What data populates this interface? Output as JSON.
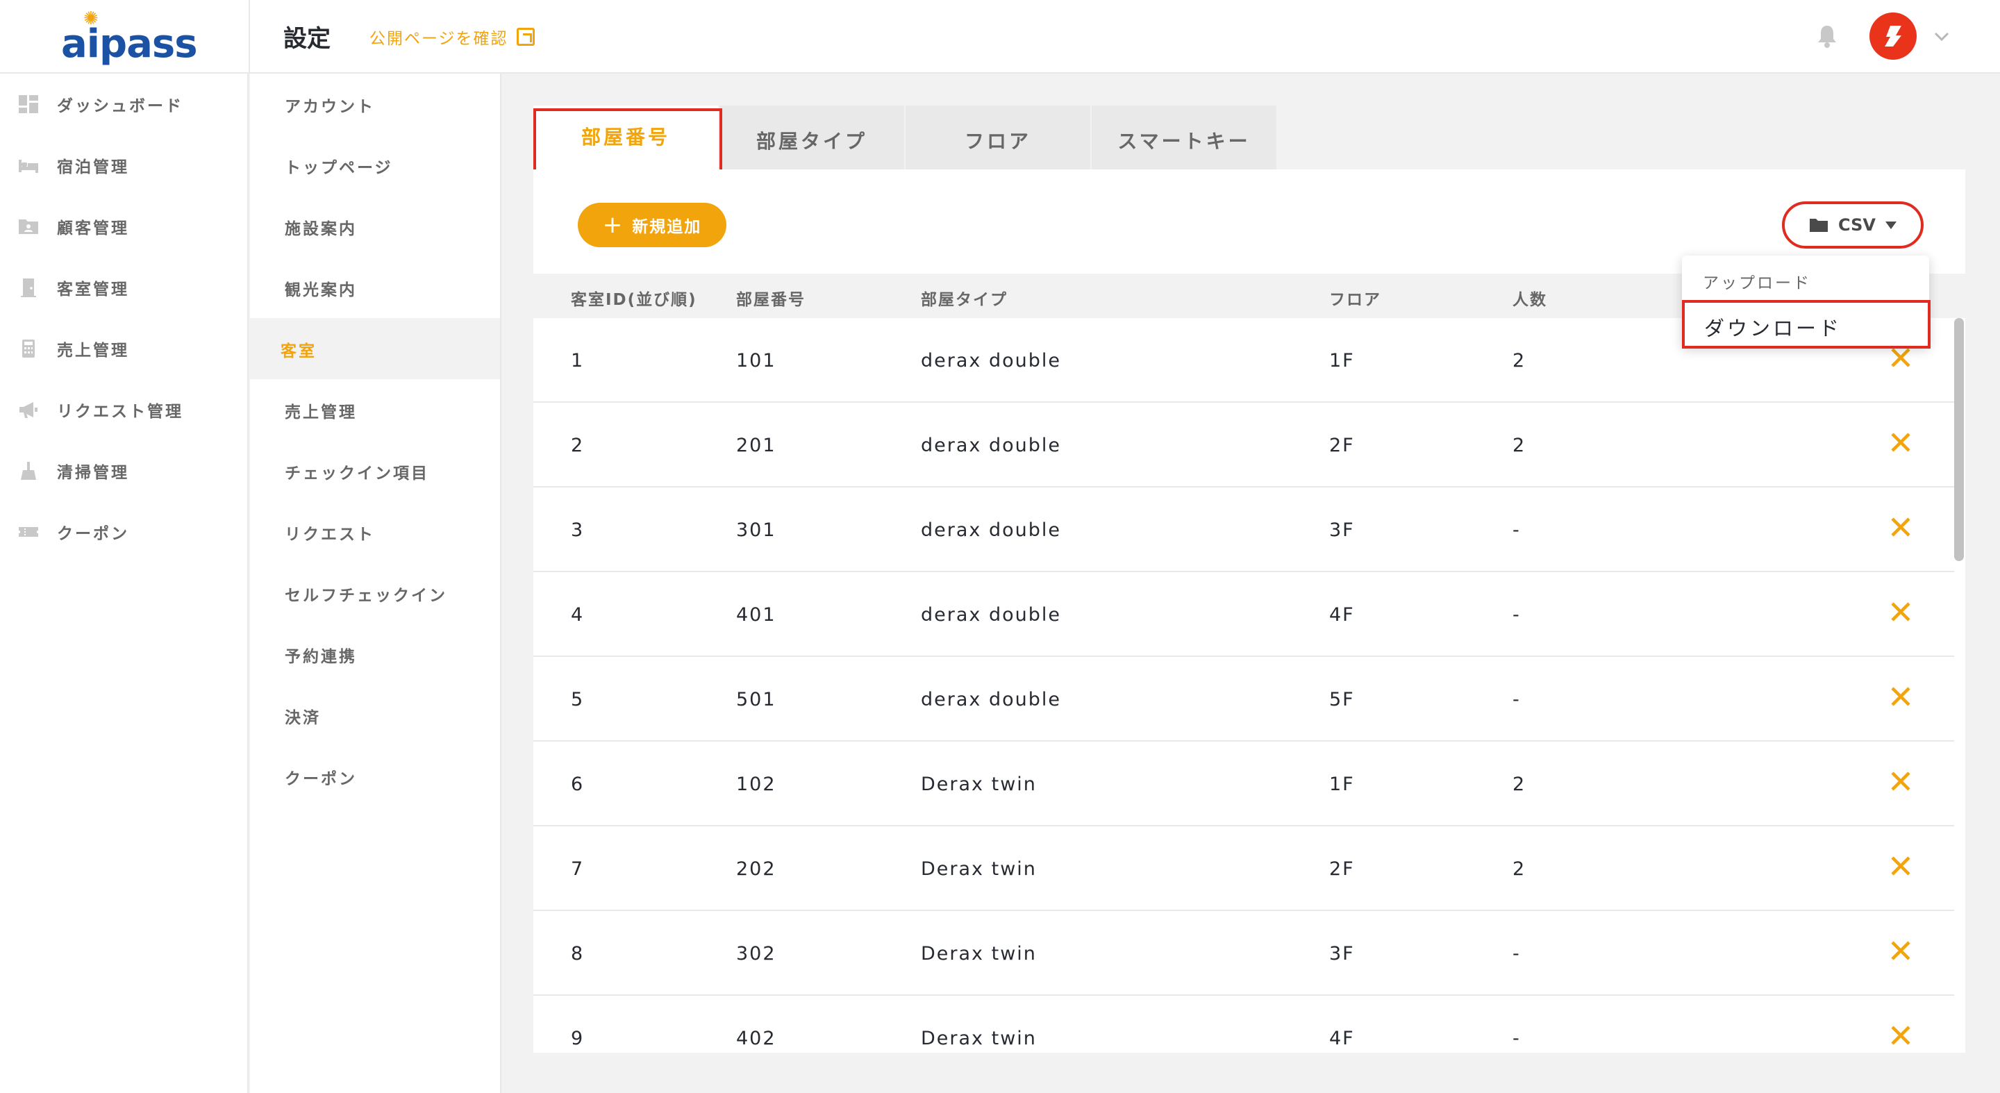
{
  "header": {
    "logo": "aipass",
    "title": "設定",
    "public_link": "公開ページを確認"
  },
  "sidebar": {
    "items": [
      {
        "label": "ダッシュボード",
        "icon": "dashboard-icon"
      },
      {
        "label": "宿泊管理",
        "icon": "bed-icon"
      },
      {
        "label": "顧客管理",
        "icon": "customer-folder-icon"
      },
      {
        "label": "客室管理",
        "icon": "door-icon"
      },
      {
        "label": "売上管理",
        "icon": "calculator-icon"
      },
      {
        "label": "リクエスト管理",
        "icon": "megaphone-icon"
      },
      {
        "label": "清掃管理",
        "icon": "broom-icon"
      },
      {
        "label": "クーポン",
        "icon": "ticket-icon"
      }
    ]
  },
  "settings_nav": {
    "items": [
      {
        "label": "アカウント"
      },
      {
        "label": "トップページ"
      },
      {
        "label": "施設案内"
      },
      {
        "label": "観光案内"
      },
      {
        "label": "客室",
        "active": true
      },
      {
        "label": "売上管理"
      },
      {
        "label": "チェックイン項目"
      },
      {
        "label": "リクエスト"
      },
      {
        "label": "セルフチェックイン"
      },
      {
        "label": "予約連携"
      },
      {
        "label": "決済"
      },
      {
        "label": "クーポン"
      }
    ]
  },
  "tabs": [
    {
      "label": "部屋番号",
      "active": true
    },
    {
      "label": "部屋タイプ"
    },
    {
      "label": "フロア"
    },
    {
      "label": "スマートキー"
    }
  ],
  "toolbar": {
    "add_label": "新規追加",
    "csv_label": "CSV"
  },
  "csv_menu": {
    "upload": "アップロード",
    "download": "ダウンロード"
  },
  "table": {
    "columns": [
      "客室ID(並び順)",
      "部屋番号",
      "部屋タイプ",
      "フロア",
      "人数"
    ],
    "rows": [
      [
        "1",
        "101",
        "derax double",
        "1F",
        "2"
      ],
      [
        "2",
        "201",
        "derax double",
        "2F",
        "2"
      ],
      [
        "3",
        "301",
        "derax double",
        "3F",
        "-"
      ],
      [
        "4",
        "401",
        "derax double",
        "4F",
        "-"
      ],
      [
        "5",
        "501",
        "derax double",
        "5F",
        "-"
      ],
      [
        "6",
        "102",
        "Derax twin",
        "1F",
        "2"
      ],
      [
        "7",
        "202",
        "Derax twin",
        "2F",
        "2"
      ],
      [
        "8",
        "302",
        "Derax twin",
        "3F",
        "-"
      ],
      [
        "9",
        "402",
        "Derax twin",
        "4F",
        "-"
      ]
    ]
  },
  "colors": {
    "accent": "#f2a40c",
    "highlight": "#e02c20",
    "brand": "#1c52a4",
    "text": "#272a31",
    "muted": "#676767"
  }
}
